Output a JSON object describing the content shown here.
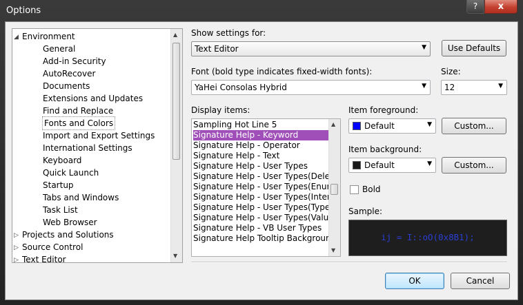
{
  "window": {
    "title": "Options",
    "help_label": "?",
    "close_label": "x"
  },
  "tree": {
    "items": [
      {
        "label": "Environment",
        "expander": "◢",
        "level": 1
      },
      {
        "label": "General",
        "expander": "",
        "level": 2
      },
      {
        "label": "Add-in Security",
        "expander": "",
        "level": 2
      },
      {
        "label": "AutoRecover",
        "expander": "",
        "level": 2
      },
      {
        "label": "Documents",
        "expander": "",
        "level": 2
      },
      {
        "label": "Extensions and Updates",
        "expander": "",
        "level": 2
      },
      {
        "label": "Find and Replace",
        "expander": "",
        "level": 2
      },
      {
        "label": "Fonts and Colors",
        "expander": "",
        "level": 2
      },
      {
        "label": "Import and Export Settings",
        "expander": "",
        "level": 2
      },
      {
        "label": "International Settings",
        "expander": "",
        "level": 2
      },
      {
        "label": "Keyboard",
        "expander": "",
        "level": 2
      },
      {
        "label": "Quick Launch",
        "expander": "",
        "level": 2
      },
      {
        "label": "Startup",
        "expander": "",
        "level": 2
      },
      {
        "label": "Tabs and Windows",
        "expander": "",
        "level": 2
      },
      {
        "label": "Task List",
        "expander": "",
        "level": 2
      },
      {
        "label": "Web Browser",
        "expander": "",
        "level": 2
      },
      {
        "label": "Projects and Solutions",
        "expander": "▷",
        "level": 1
      },
      {
        "label": "Source Control",
        "expander": "▷",
        "level": 1
      },
      {
        "label": "Text Editor",
        "expander": "▷",
        "level": 1
      }
    ],
    "selected": "Fonts and Colors"
  },
  "show_settings": {
    "label": "Show settings for:",
    "value": "Text Editor",
    "use_defaults": "Use Defaults"
  },
  "font": {
    "label": "Font (bold type indicates fixed-width fonts):",
    "value": "YaHei Consolas Hybrid"
  },
  "size": {
    "label": "Size:",
    "value": "12"
  },
  "display_items": {
    "label": "Display items:",
    "items": [
      "Sampling Hot Line 5",
      "Signature Help - Keyword",
      "Signature Help - Operator",
      "Signature Help - Text",
      "Signature Help - User Types",
      "Signature Help - User Types(Delegates)",
      "Signature Help - User Types(Enums)",
      "Signature Help - User Types(Interfaces)",
      "Signature Help - User Types(Type parameters)",
      "Signature Help - User Types(Value Types)",
      "Signature Help - VB User Types",
      "Signature Help Tooltip Background"
    ],
    "selected_index": 1
  },
  "item_foreground": {
    "label": "Item foreground:",
    "value": "Default",
    "swatch_color": "#0000ff",
    "custom_label": "Custom..."
  },
  "item_background": {
    "label": "Item background:",
    "value": "Default",
    "swatch_color": "#1a1a1a",
    "custom_label": "Custom..."
  },
  "bold": {
    "label": "Bold",
    "checked": false
  },
  "sample": {
    "label": "Sample:",
    "text": "ij = I::oO(0x8B1);",
    "text_color": "#2a3fd4",
    "background": "#1e1e1e"
  },
  "footer": {
    "ok_label": "OK",
    "cancel_label": "Cancel"
  },
  "icons": {
    "dropdown": "▼",
    "scroll_up": "▲",
    "scroll_down": "▼"
  }
}
